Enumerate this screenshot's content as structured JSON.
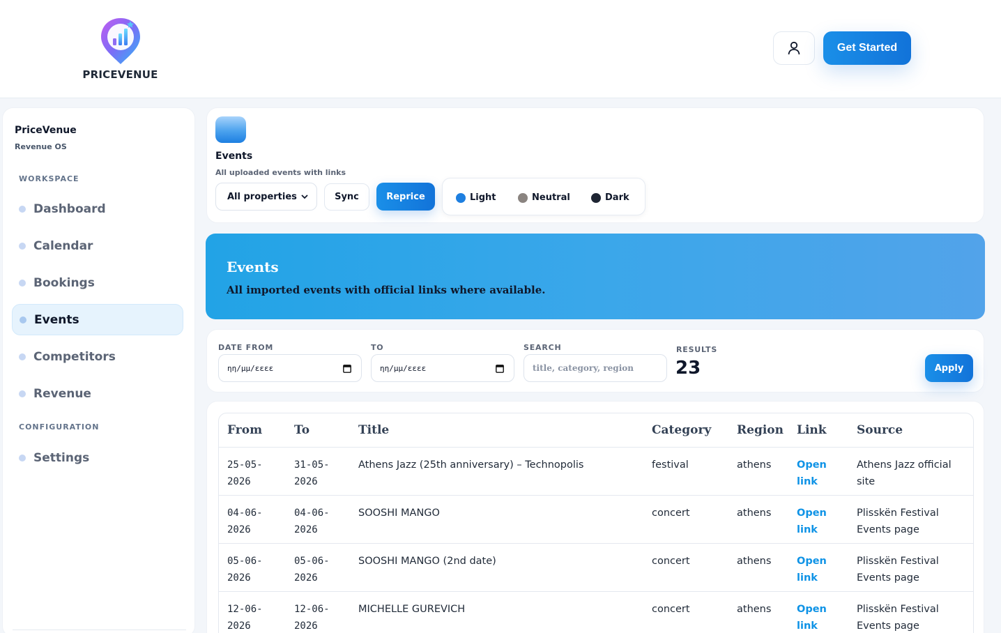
{
  "brand": {
    "name": "PRICEVENUE"
  },
  "header": {
    "cta_label": "Get Started"
  },
  "sidebar": {
    "title": "PriceVenue",
    "subtitle": "Revenue OS",
    "section_workspace": "WORKSPACE",
    "section_configuration": "CONFIGURATION",
    "items": [
      {
        "label": "Dashboard"
      },
      {
        "label": "Calendar"
      },
      {
        "label": "Bookings"
      },
      {
        "label": "Events"
      },
      {
        "label": "Competitors"
      },
      {
        "label": "Revenue"
      },
      {
        "label": "Settings"
      }
    ]
  },
  "events_card": {
    "title": "Events",
    "subtitle": "All uploaded events with links",
    "property_select": "All properties",
    "sync_label": "Sync",
    "reprice_label": "Reprice",
    "themes": [
      {
        "label": "Light",
        "color": "#1e7fe0"
      },
      {
        "label": "Neutral",
        "color": "#8a8480"
      },
      {
        "label": "Dark",
        "color": "#1e2533"
      }
    ]
  },
  "banner": {
    "title": "Events",
    "subtitle": "All imported events with official links where available."
  },
  "filters": {
    "date_from_label": "DATE FROM",
    "date_from_value": "ηη/μμ/εεεε",
    "to_label": "TO",
    "to_value": "ηη/μμ/εεεε",
    "search_label": "SEARCH",
    "search_placeholder": "title, category, region",
    "results_label": "RESULTS",
    "results_value": "23",
    "apply_label": "Apply"
  },
  "table": {
    "headers": [
      "From",
      "To",
      "Title",
      "Category",
      "Region",
      "Link",
      "Source"
    ],
    "rows": [
      {
        "from": "25-05-2026",
        "to": "31-05-2026",
        "title": "Athens Jazz (25th anniversary) – Technopolis",
        "category": "festival",
        "region": "athens",
        "link": "Open link",
        "source": "Athens Jazz official site"
      },
      {
        "from": "04-06-2026",
        "to": "04-06-2026",
        "title": "SOOSHI MANGO",
        "category": "concert",
        "region": "athens",
        "link": "Open link",
        "source": "Plisskën Festival Events page"
      },
      {
        "from": "05-06-2026",
        "to": "05-06-2026",
        "title": "SOOSHI MANGO (2nd date)",
        "category": "concert",
        "region": "athens",
        "link": "Open link",
        "source": "Plisskën Festival Events page"
      },
      {
        "from": "12-06-2026",
        "to": "12-06-2026",
        "title": "MICHELLE GUREVICH",
        "category": "concert",
        "region": "athens",
        "link": "Open link",
        "source": "Plisskën Festival Events page"
      }
    ]
  }
}
